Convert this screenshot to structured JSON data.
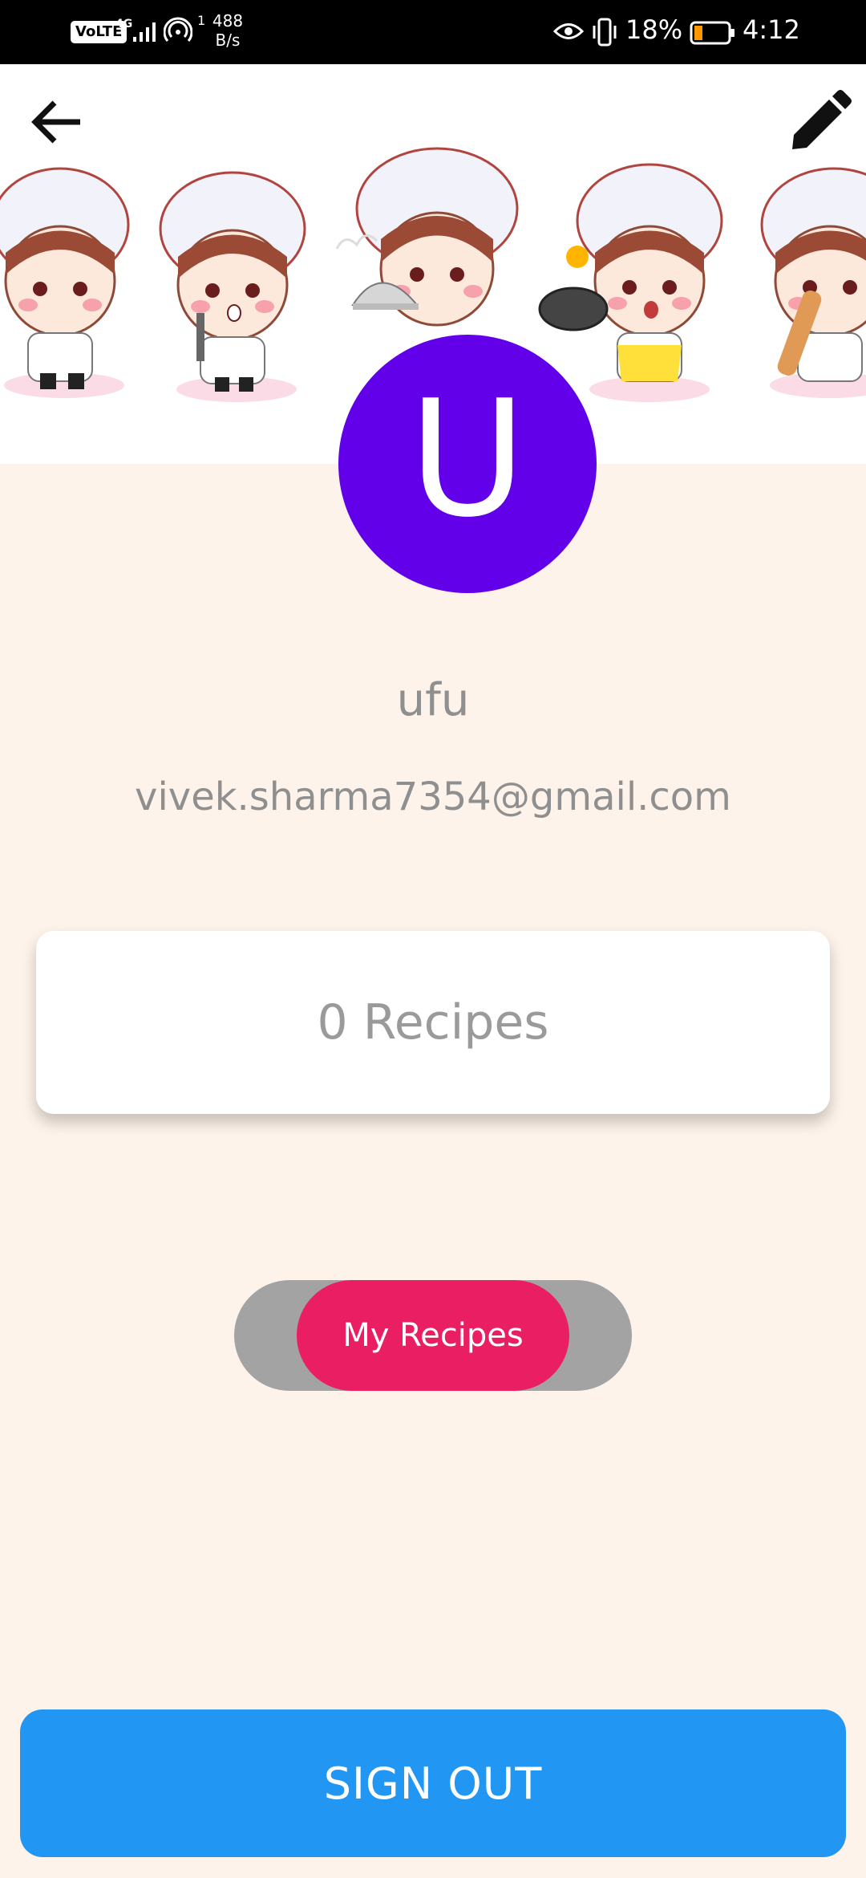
{
  "status_bar": {
    "volte": "VoLTE",
    "network": "4G",
    "sim_slot": "1",
    "speed_value": "488",
    "speed_unit": "B/s",
    "battery_percent": "18%",
    "time": "4:12"
  },
  "header": {
    "back_icon": "arrow-back-icon",
    "edit_icon": "pencil-icon",
    "banner": "chef-characters-illustration"
  },
  "profile": {
    "avatar_letter": "U",
    "avatar_color": "#6200ea",
    "username": "ufu",
    "email": "vivek.sharma7354@gmail.com"
  },
  "stats": {
    "recipes_count": "0 Recipes"
  },
  "toggle": {
    "label": "My Recipes",
    "thumb_color": "#e91e63",
    "track_color": "#a3a3a3"
  },
  "actions": {
    "sign_out": "SIGN OUT",
    "sign_out_color": "#2196f3"
  },
  "colors": {
    "background": "#fdf3ea"
  }
}
